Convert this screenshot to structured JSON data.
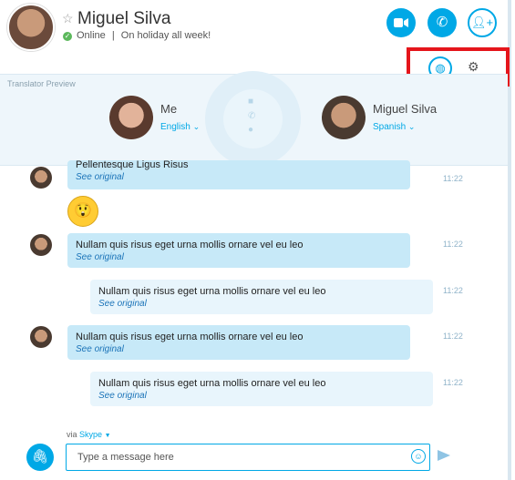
{
  "header": {
    "contact_name": "Miguel Silva",
    "status_label": "Online",
    "mood_message": "On holiday all week!",
    "status_separator": "|",
    "star_icon": "star-outline-icon",
    "video_call_icon": "video-camera-icon",
    "audio_call_icon": "phone-icon",
    "add_people_icon": "add-person-icon"
  },
  "toolbar": {
    "translator_icon": "globe-translator-icon",
    "settings_icon": "gear-icon",
    "highlight_color": "#e5151b"
  },
  "translator": {
    "title": "Translator Preview",
    "me": {
      "name": "Me",
      "language": "English"
    },
    "contact": {
      "name": "Miguel Silva",
      "language": "Spanish"
    }
  },
  "messages": [
    {
      "text": "Pellentesque Ligus Risus",
      "link": "See original",
      "time": "11:22",
      "direction": "in"
    },
    {
      "emoji": "surprised-emoticon",
      "direction": "in"
    },
    {
      "text": "Nullam quis risus eget urna mollis ornare vel eu leo",
      "link": "See original",
      "time": "11:22",
      "direction": "in"
    },
    {
      "text": "Nullam quis risus eget urna mollis ornare vel eu leo",
      "link": "See original",
      "time": "11:22",
      "direction": "out"
    },
    {
      "text": "Nullam quis risus eget urna mollis ornare vel eu leo",
      "link": "See original",
      "time": "11:22",
      "direction": "in"
    },
    {
      "text": "Nullam quis risus eget urna mollis ornare vel eu leo",
      "link": "See original",
      "time": "11:22",
      "direction": "out"
    }
  ],
  "composer": {
    "via_prefix": "via",
    "via_service": "Skype",
    "placeholder": "Type a message here",
    "attach_icon": "paperclip-icon",
    "emoticon_icon": "smiley-icon",
    "send_icon": "send-arrow-icon"
  },
  "colors": {
    "accent": "#00a8e6",
    "incoming_bubble": "#c7e9f8",
    "outgoing_bubble": "#e8f5fc",
    "online": "#5cb85c"
  }
}
